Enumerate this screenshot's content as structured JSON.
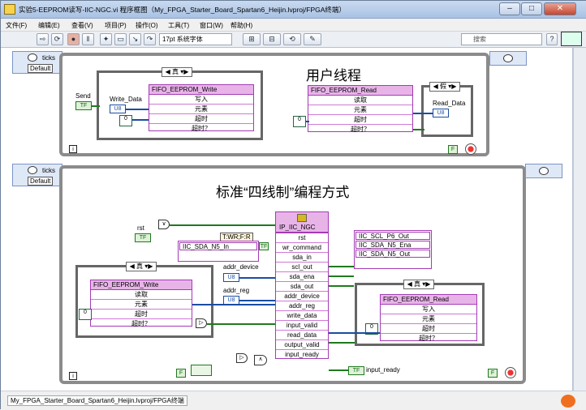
{
  "window": {
    "title": "实验5-EEPROM读写-IIC-NGC.vi 程序框图（My_FPGA_Starter_Board_Spartan6_Heijin.lvproj/FPGA终端）",
    "btn_min": "–",
    "btn_max": "□",
    "btn_close": "✕"
  },
  "menu": {
    "items": [
      "文件(F)",
      "编辑(E)",
      "查看(V)",
      "项目(P)",
      "操作(O)",
      "工具(T)",
      "窗口(W)",
      "帮助(H)"
    ]
  },
  "toolbar": {
    "font_select": "17pt 系统字体",
    "search_placeholder": "搜索"
  },
  "top_loop": {
    "title": "用户线程",
    "timed_ticks": "ticks",
    "timed_default": "Default",
    "case_write_selector": "真",
    "case_read_selector": "假",
    "send_label": "Send",
    "write_data_label": "Write_Data",
    "read_data_label": "Read_Data",
    "const_zero": "0",
    "write_node_title": "FIFO_EEPROM_Write",
    "write_rows": [
      "写入",
      "元素",
      "超时",
      "超时？"
    ],
    "read_node_title": "FIFO_EEPROM_Read",
    "read_rows": [
      "读取",
      "元素",
      "超时",
      "超时？"
    ],
    "tf_label": "TF",
    "u8_label": "U8",
    "i_label": "i",
    "f_label": "F"
  },
  "bottom_loop": {
    "title": "标准“四线制”编程方式",
    "timed_ticks": "ticks",
    "timed_default": "Default",
    "rst_label": "rst",
    "tw_label": "T:WR;F:R",
    "ip_title": "IP_IIC_NGC",
    "ip_rows": [
      "rst",
      "wr_command",
      "sda_in",
      "scl_out",
      "sda_ena",
      "sda_out",
      "addr_device",
      "addr_reg",
      "write_data",
      "input_valid",
      "read_data",
      "output_valid",
      "input_ready"
    ],
    "sda_in_node": "IIC_SDA_N5_In",
    "out_nodes": [
      "IIC_SCL_P6_Out",
      "IIC_SDA_N5_Ena",
      "IIC_SDA_N5_Out"
    ],
    "addr_device_label": "addr_device",
    "addr_reg_label": "addr_reg",
    "input_ready_label": "input_ready",
    "case_left_selector": "真",
    "case_right_selector": "真",
    "left_node_title": "FIFO_EEPROM_Write",
    "left_rows": [
      "读取",
      "元素",
      "超时",
      "超时？"
    ],
    "right_node_title": "FIFO_EEPROM_Read",
    "right_rows": [
      "写入",
      "元素",
      "超时",
      "超时？"
    ],
    "const_zero": "0",
    "tf_label": "TF",
    "u8_label": "U8",
    "i_label": "i",
    "f_label": "F"
  },
  "status": {
    "text": "My_FPGA_Starter_Board_Spartan6_Heijin.lvproj/FPGA终端"
  },
  "colors": {
    "loop_border": "#8b8b8b",
    "node_accent": "#a43bb5",
    "wire_int": "#1a4da3",
    "wire_bool": "#1f7a1f"
  }
}
